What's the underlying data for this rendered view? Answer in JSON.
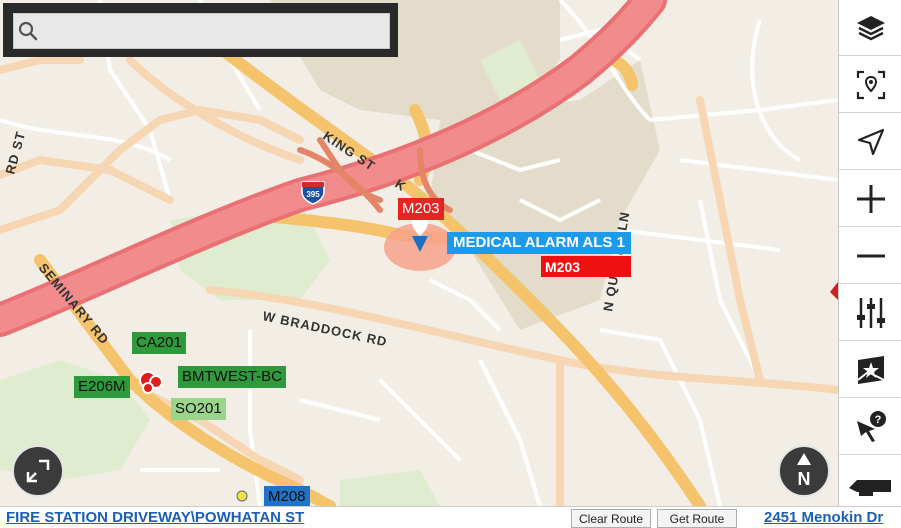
{
  "search": {
    "placeholder": "",
    "value": ""
  },
  "map": {
    "road_labels": {
      "king_st": "KING ST",
      "king_st_2": "K",
      "w_braddock": "W BRADDOCK RD",
      "seminary": "SEMINARY RD",
      "rd_st": "RD ST",
      "n_quaker": "N QUAKER LN",
      "interstate": "395"
    },
    "incident": {
      "unit": "M203",
      "type": "MEDICAL ALARM ALS 1",
      "assigned": "M203"
    },
    "units": {
      "ca201": "CA201",
      "e206m": "E206M",
      "bmtwest": "BMTWEST-BC",
      "so201": "SO201",
      "m208": "M208"
    }
  },
  "toolbar": {
    "items": [
      "layers-icon",
      "locate-area-icon",
      "navigate-icon",
      "zoom-in-icon",
      "zoom-out-icon",
      "settings-sliders-icon",
      "map-star-icon",
      "help-pointer-icon",
      "truck-icon"
    ]
  },
  "compass_label": "N",
  "statusbar": {
    "left_address": "FIRE STATION DRIVEWAY\\POWHATAN ST",
    "clear_route": "Clear Route",
    "get_route": "Get Route",
    "right_address": "2451 Menokin Dr"
  },
  "colors": {
    "highway": "#f07c7c",
    "major_road": "#f4c36b",
    "incident_blue": "#1d9be9",
    "unit_green": "#2f9a3c",
    "unit_red": "#ee1111"
  }
}
